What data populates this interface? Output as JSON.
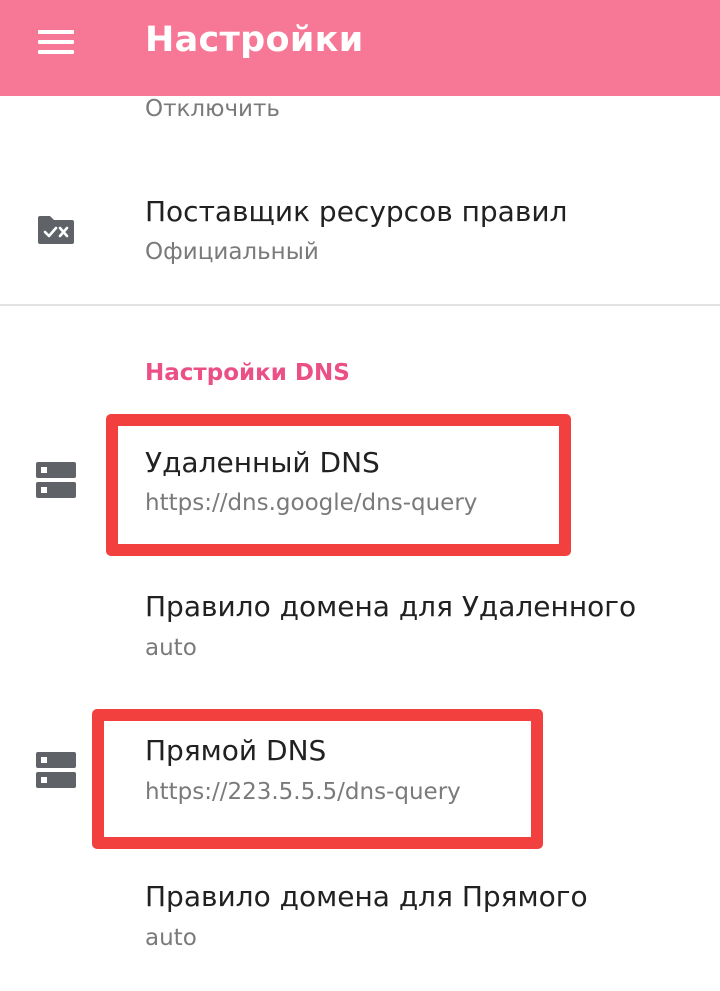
{
  "appbar": {
    "title": "Настройки",
    "menu_icon": "hamburger-menu-icon",
    "background_color": "#f77896"
  },
  "rows": {
    "disable": {
      "subtitle": "Отключить",
      "icon": "storage-icon"
    },
    "rule_provider": {
      "title": "Поставщик ресурсов правил",
      "subtitle": "Официальный",
      "icon": "folder-check-cross-icon"
    }
  },
  "dns_section": {
    "header": "Настройки DNS",
    "accent_color": "#ea4f86",
    "remote_dns": {
      "title": "Удаленный DNS",
      "value": "https://dns.google/dns-query",
      "icon": "dns-server-icon"
    },
    "remote_domain_rule": {
      "title": "Правило домена для Удаленного",
      "value": "auto"
    },
    "direct_dns": {
      "title": "Прямой DNS",
      "value": "https://223.5.5.5/dns-query",
      "icon": "dns-server-icon"
    },
    "direct_domain_rule": {
      "title": "Правило домена для Прямого",
      "value": "auto"
    }
  },
  "annotation_color": "#f2403f"
}
